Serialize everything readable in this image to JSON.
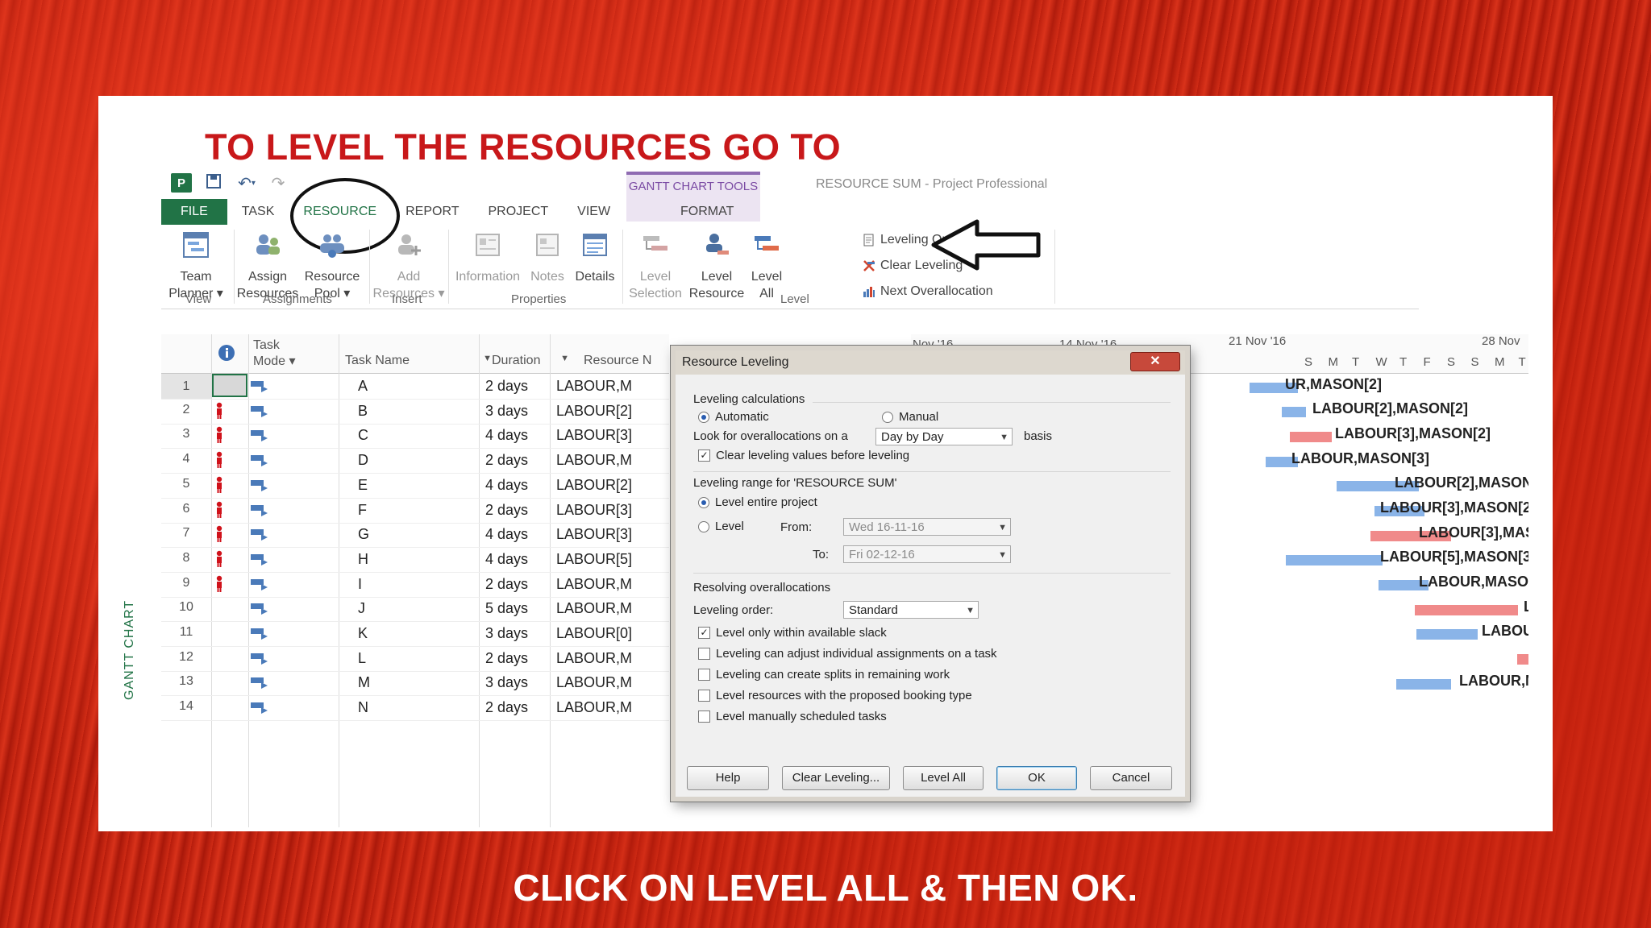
{
  "headline": "TO LEVEL THE RESOURCES GO TO",
  "footer": "CLICK ON LEVEL ALL & THEN OK.",
  "window_title": "RESOURCE SUM - Project Professional",
  "context_tools": "GANTT CHART TOOLS",
  "app_icon": "P",
  "tabs": [
    "FILE",
    "TASK",
    "RESOURCE",
    "REPORT",
    "PROJECT",
    "VIEW",
    "FORMAT"
  ],
  "ribbon": {
    "team_planner": [
      "Team",
      "Planner ▾"
    ],
    "assign_resources": [
      "Assign",
      "Resources"
    ],
    "resource_pool": [
      "Resource",
      "Pool ▾"
    ],
    "add_resources": [
      "Add",
      "Resources ▾"
    ],
    "information": "Information",
    "notes": "Notes",
    "details": "Details",
    "level_selection": [
      "Level",
      "Selection"
    ],
    "level_resource": [
      "Level",
      "Resource"
    ],
    "level_all": [
      "Level",
      "All"
    ],
    "leveling_options": "Leveling Options",
    "clear_leveling": "Clear Leveling",
    "next_overallocation": "Next Overallocation",
    "groups": {
      "view": "View",
      "assignments": "Assignments",
      "insert": "Insert",
      "properties": "Properties",
      "level": "Level"
    }
  },
  "grid": {
    "headers": {
      "task_mode": [
        "Task",
        "Mode ▾"
      ],
      "task_name": "Task Name",
      "duration": "Duration",
      "resource": "Resource N"
    },
    "rows": [
      {
        "id": "1",
        "name": "A",
        "duration": "2 days",
        "resource": "LABOUR,M",
        "flag": false
      },
      {
        "id": "2",
        "name": "B",
        "duration": "3 days",
        "resource": "LABOUR[2]",
        "flag": true
      },
      {
        "id": "3",
        "name": "C",
        "duration": "4 days",
        "resource": "LABOUR[3]",
        "flag": true
      },
      {
        "id": "4",
        "name": "D",
        "duration": "2 days",
        "resource": "LABOUR,M",
        "flag": true
      },
      {
        "id": "5",
        "name": "E",
        "duration": "4 days",
        "resource": "LABOUR[2]",
        "flag": true
      },
      {
        "id": "6",
        "name": "F",
        "duration": "2 days",
        "resource": "LABOUR[3]",
        "flag": true
      },
      {
        "id": "7",
        "name": "G",
        "duration": "4 days",
        "resource": "LABOUR[3]",
        "flag": true
      },
      {
        "id": "8",
        "name": "H",
        "duration": "4 days",
        "resource": "LABOUR[5]",
        "flag": true
      },
      {
        "id": "9",
        "name": "I",
        "duration": "2 days",
        "resource": "LABOUR,M",
        "flag": true
      },
      {
        "id": "10",
        "name": "J",
        "duration": "5 days",
        "resource": "LABOUR,M",
        "flag": false
      },
      {
        "id": "11",
        "name": "K",
        "duration": "3 days",
        "resource": "LABOUR[0]",
        "flag": false
      },
      {
        "id": "12",
        "name": "L",
        "duration": "2 days",
        "resource": "LABOUR,M",
        "flag": false
      },
      {
        "id": "13",
        "name": "M",
        "duration": "3 days",
        "resource": "LABOUR,M",
        "flag": false
      },
      {
        "id": "14",
        "name": "N",
        "duration": "2 days",
        "resource": "LABOUR,M",
        "flag": false
      }
    ],
    "side_label": "GANTT CHART"
  },
  "gantt": {
    "timescale": [
      "Nov '16",
      "14 Nov '16",
      "21 Nov '16",
      "28 Nov"
    ],
    "days": [
      "S",
      "M",
      "T",
      "W",
      "T",
      "F",
      "S",
      "S",
      "M",
      "T"
    ],
    "labels": [
      "UR,MASON[2]",
      "LABOUR[2],MASON[2]",
      "LABOUR[3],MASON[2]",
      "LABOUR,MASON[3]",
      "LABOUR[2],MASON",
      "LABOUR[3],MASON[2",
      "LABOUR[3],MAS",
      "LABOUR[5],MASON[3",
      "LABOUR,MASON",
      "L",
      "LABOU",
      "LABOUR,M"
    ]
  },
  "dialog": {
    "title": "Resource Leveling",
    "close": "✕",
    "sec_calc": "Leveling calculations",
    "automatic": "Automatic",
    "manual": "Manual",
    "look_for": "Look for overallocations on a",
    "basis_value": "Day by Day",
    "basis": "basis",
    "clear_values": "Clear leveling values before leveling",
    "sec_range": "Leveling range for 'RESOURCE SUM'",
    "entire": "Level entire project",
    "level": "Level",
    "from_label": "From:",
    "from_value": "Wed 16-11-16",
    "to_label": "To:",
    "to_value": "Fri 02-12-16",
    "sec_resolve": "Resolving overallocations",
    "order_label": "Leveling order:",
    "order_value": "Standard",
    "opt1": "Level only within available slack",
    "opt2": "Leveling can adjust individual assignments on a task",
    "opt3": "Leveling can create splits in remaining work",
    "opt4": "Level resources with the proposed booking type",
    "opt5": "Level manually scheduled tasks",
    "btn_help": "Help",
    "btn_clear": "Clear Leveling...",
    "btn_levelall": "Level All",
    "btn_ok": "OK",
    "btn_cancel": "Cancel"
  },
  "colors": {
    "accent": "#217346",
    "headline": "#c8181a",
    "bar_blue": "#8ab4e8",
    "bar_red": "#f08a8a"
  }
}
